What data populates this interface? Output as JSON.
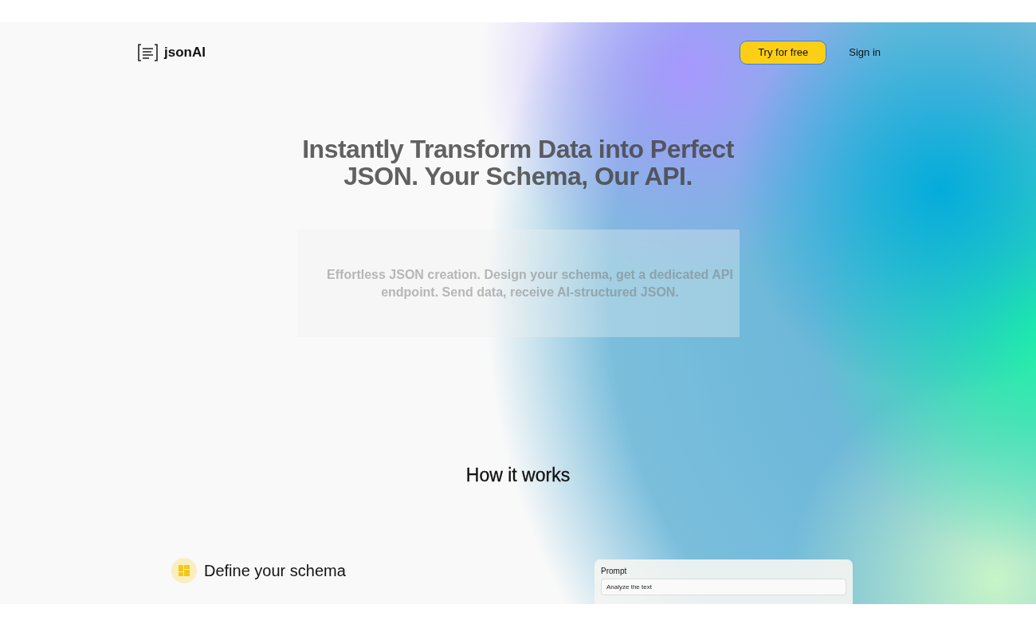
{
  "header": {
    "logo_text": "jsonAI",
    "buttons": [
      {
        "label": "Try for free",
        "kind": "primary"
      },
      {
        "label": "Sign in",
        "kind": "link"
      }
    ]
  },
  "hero": {
    "title": "Instantly Transform Data into Perfect JSON. Your Schema, Our API.",
    "subtitle": "Effortless JSON creation. Design your schema, get a dedicated API endpoint. Send data, receive AI-structured JSON."
  },
  "how_it_works": {
    "heading": "How it works",
    "step": {
      "title": "Define your schema"
    },
    "prompt_card": {
      "label": "Prompt",
      "value": "Analyze the text"
    }
  }
}
